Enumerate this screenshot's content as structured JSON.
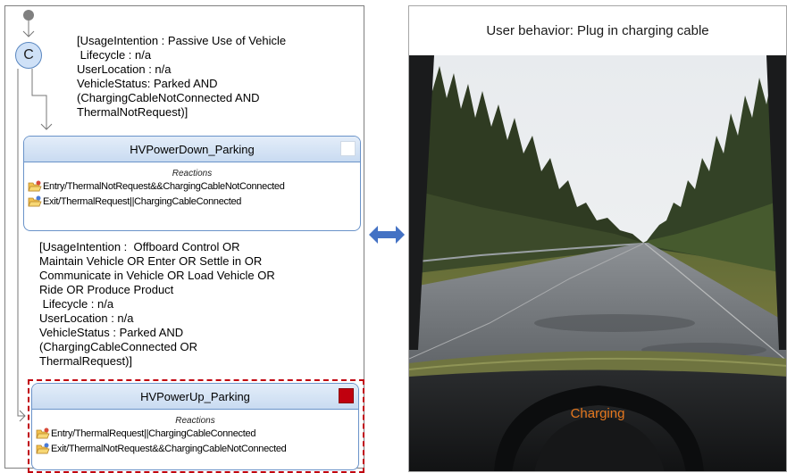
{
  "statechart": {
    "choice_symbol": "C",
    "guard_enter_powerdown": "[UsageIntention : Passive Use of Vehicle\n Lifecycle : n/a\nUserLocation : n/a\nVehicleStatus: Parked AND\n(ChargingCableNotConnected AND\nThermalNotRequest)]",
    "guard_enter_powerup": "[UsageIntention :  Offboard Control OR\nMaintain Vehicle OR Enter OR Settle in OR\nCommunicate in Vehicle OR Load Vehicle OR\nRide OR Produce Product\n Lifecycle : n/a\nUserLocation : n/a\nVehicleStatus : Parked AND\n(ChargingCableConnected OR\nThermalRequest)]",
    "states": [
      {
        "name": "HVPowerDown_Parking",
        "reactions_title": "Reactions",
        "entry": "Entry/ThermalNotRequest&&ChargingCableNotConnected",
        "exit": "Exit/ThermalRequest||ChargingCableConnected",
        "active": false
      },
      {
        "name": "HVPowerUp_Parking",
        "reactions_title": "Reactions",
        "entry": "Entry/ThermalRequest||ChargingCableConnected",
        "exit": "Exit/ThermalNotRequest&&ChargingCableNotConnected",
        "active": true
      }
    ],
    "colors": {
      "active_state": "#c0000e",
      "state_border": "#6a93c9",
      "arrow": "#4472c4"
    }
  },
  "simulation": {
    "title": "User behavior: Plug in charging cable",
    "status": "Charging",
    "status_color": "#e6781e"
  }
}
